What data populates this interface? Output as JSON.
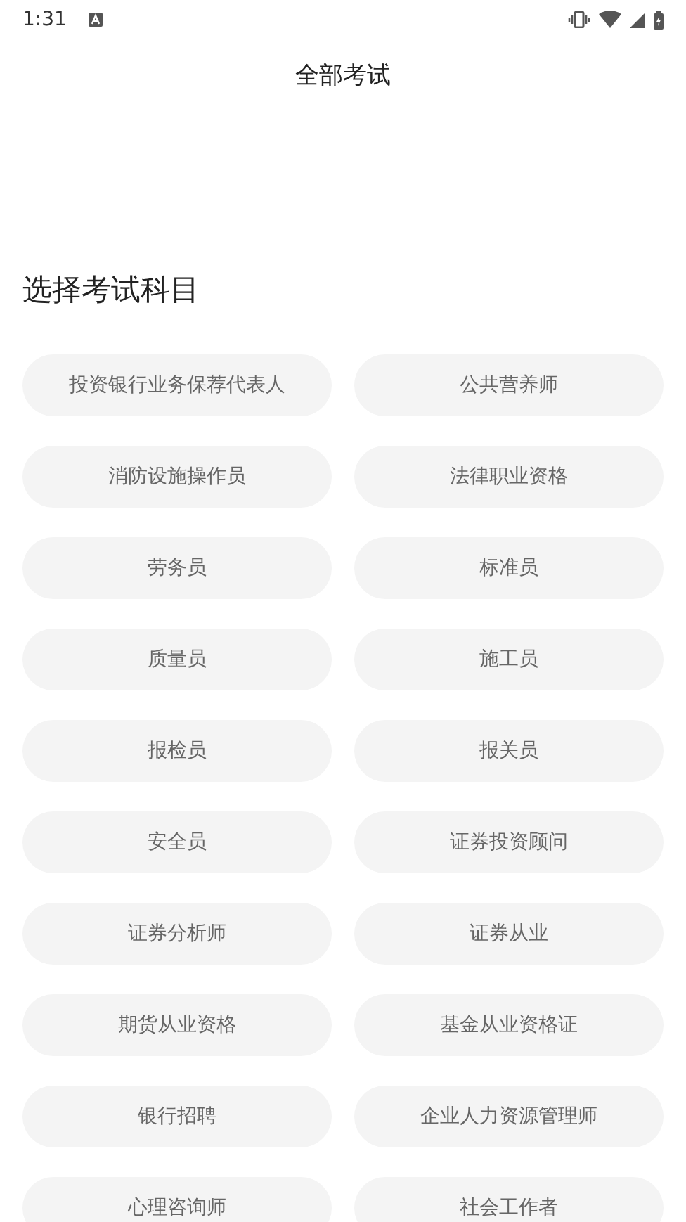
{
  "status_bar": {
    "time": "1:31"
  },
  "header": {
    "title": "全部考试"
  },
  "section": {
    "heading": "选择考试科目"
  },
  "exams": [
    {
      "label": "投资银行业务保荐代表人"
    },
    {
      "label": "公共营养师"
    },
    {
      "label": "消防设施操作员"
    },
    {
      "label": "法律职业资格"
    },
    {
      "label": "劳务员"
    },
    {
      "label": "标准员"
    },
    {
      "label": "质量员"
    },
    {
      "label": "施工员"
    },
    {
      "label": "报检员"
    },
    {
      "label": "报关员"
    },
    {
      "label": "安全员"
    },
    {
      "label": "证券投资顾问"
    },
    {
      "label": "证券分析师"
    },
    {
      "label": "证券从业"
    },
    {
      "label": "期货从业资格"
    },
    {
      "label": "基金从业资格证"
    },
    {
      "label": "银行招聘"
    },
    {
      "label": "企业人力资源管理师"
    },
    {
      "label": "心理咨询师"
    },
    {
      "label": "社会工作者"
    }
  ]
}
